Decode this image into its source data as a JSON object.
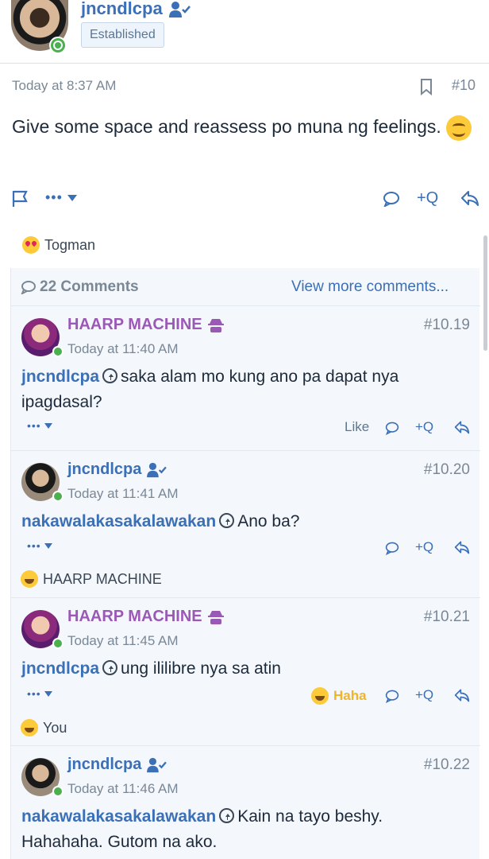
{
  "header": {
    "username": "jncndlcpa",
    "badge": "Established",
    "icons": [
      "user-check-icon",
      "online-status-icon"
    ]
  },
  "post": {
    "timestamp": "Today at 8:37 AM",
    "number": "#10",
    "body": "Give some space and reassess po muna ng feelings.",
    "icons": [
      "bookmark-icon",
      "flag-icon",
      "more-options-icon",
      "comment-icon",
      "multi-quote-icon",
      "reply-icon"
    ],
    "multi_quote_label": "+Q",
    "more_label": "•••",
    "reaction_user": "Togman"
  },
  "comments_section": {
    "count_label": "22 Comments",
    "view_more_label": "View more comments...",
    "items": [
      {
        "author": "HAARP MACHINE",
        "time": "Today at 11:40 AM",
        "number": "#10.19",
        "mention": "jncndlcpa",
        "text": "saka alam mo kung ano pa dapat nya ipagdasal?",
        "like_label": "Like",
        "reaction_user": ""
      },
      {
        "author": "jncndlcpa",
        "time": "Today at 11:41 AM",
        "number": "#10.20",
        "mention": "nakawalakasakalawakan",
        "text": "Ano ba?",
        "reaction_user": "HAARP MACHINE"
      },
      {
        "author": "HAARP MACHINE",
        "time": "Today at 11:45 AM",
        "number": "#10.21",
        "mention": "jncndlcpa",
        "text": "ung ililibre nya sa atin",
        "haha_label": "Haha",
        "reaction_user": "You"
      },
      {
        "author": "jncndlcpa",
        "time": "Today at 11:46 AM",
        "number": "#10.22",
        "mention": "nakawalakasakalawakan",
        "text": "Kain na tayo beshy. Hahahaha. Gutom na ako."
      }
    ]
  },
  "colors": {
    "link_blue": "#3b6fb6",
    "purple_name": "#9b59b6",
    "online_green": "#4caf50",
    "haha_yellow": "#f0b429",
    "muted_text": "#7a8896"
  }
}
